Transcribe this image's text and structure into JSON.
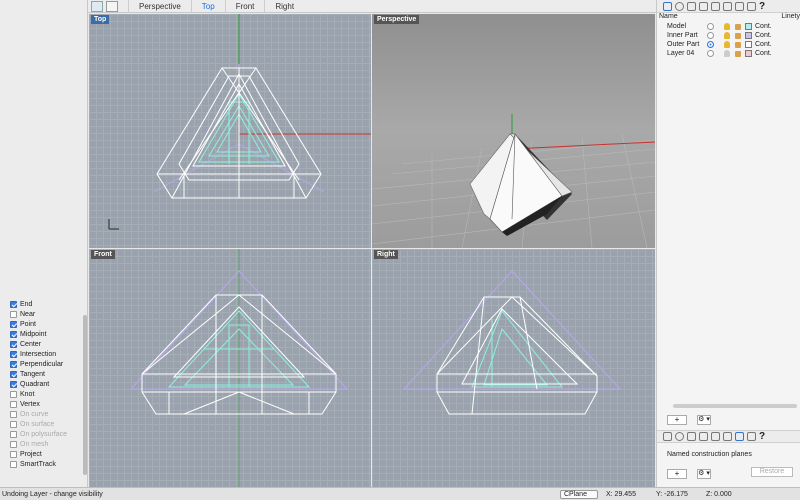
{
  "toolbar": {
    "tabs": [
      "Perspective",
      "Top",
      "Front",
      "Right"
    ],
    "active_tab": "Top"
  },
  "viewports": {
    "top_label": "Top",
    "perspective_label": "Perspective",
    "front_label": "Front",
    "right_label": "Right"
  },
  "osnaps": [
    {
      "label": "End",
      "checked": true,
      "enabled": true
    },
    {
      "label": "Near",
      "checked": false,
      "enabled": true
    },
    {
      "label": "Point",
      "checked": true,
      "enabled": true
    },
    {
      "label": "Midpoint",
      "checked": true,
      "enabled": true
    },
    {
      "label": "Center",
      "checked": true,
      "enabled": true
    },
    {
      "label": "Intersection",
      "checked": true,
      "enabled": true
    },
    {
      "label": "Perpendicular",
      "checked": true,
      "enabled": true
    },
    {
      "label": "Tangent",
      "checked": true,
      "enabled": true
    },
    {
      "label": "Quadrant",
      "checked": true,
      "enabled": true
    },
    {
      "label": "Knot",
      "checked": false,
      "enabled": true
    },
    {
      "label": "Vertex",
      "checked": false,
      "enabled": true
    },
    {
      "label": "On curve",
      "checked": false,
      "enabled": false
    },
    {
      "label": "On surface",
      "checked": false,
      "enabled": false
    },
    {
      "label": "On polysurface",
      "checked": false,
      "enabled": false
    },
    {
      "label": "On mesh",
      "checked": false,
      "enabled": false
    },
    {
      "label": "Project",
      "checked": false,
      "enabled": true
    },
    {
      "label": "SmartTrack",
      "checked": false,
      "enabled": true
    }
  ],
  "layers": {
    "header_name": "Name",
    "header_linetype": "Linety",
    "rows": [
      {
        "name": "Model",
        "current": false,
        "visible": true,
        "color": "#b8ece8",
        "linetype": "Cont."
      },
      {
        "name": "Inner Part",
        "current": false,
        "visible": true,
        "color": "#c9c0ec",
        "linetype": "Cont."
      },
      {
        "name": "Outer Part",
        "current": true,
        "visible": true,
        "color": "#ffffff",
        "linetype": "Cont."
      },
      {
        "name": "Layer 04",
        "current": false,
        "visible": false,
        "color": "#f0c8d0",
        "linetype": "Cont."
      }
    ]
  },
  "panel": {
    "add": "+",
    "remove": "−",
    "gear": "⚙ ▾",
    "named_cplanes": "Named construction planes",
    "restore": "Restore",
    "help": "?"
  },
  "status": {
    "message": "Undoing Layer - change visibility",
    "cplane": "CPlane",
    "x": "X: 29.455",
    "y": "Y: -26.175",
    "z": "Z: 0.000"
  },
  "colors": {
    "accent": "#1a6ee0",
    "viewport_label": "#3a6ca8",
    "wire_white": "#ffffff",
    "wire_cyan": "#8ff0dc",
    "wire_purple": "#b7a6ef",
    "axis_red": "#c73030",
    "axis_green": "#2d9b3b"
  }
}
